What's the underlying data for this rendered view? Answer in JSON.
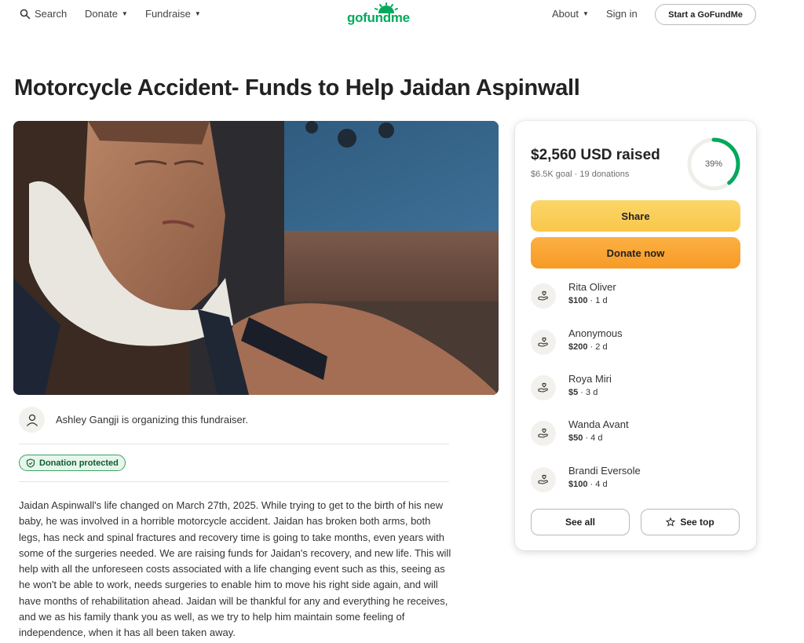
{
  "nav": {
    "search_label": "Search",
    "donate_label": "Donate",
    "fundraise_label": "Fundraise",
    "logo_text": "gofundme",
    "about_label": "About",
    "signin_label": "Sign in",
    "start_label": "Start a GoFundMe"
  },
  "campaign": {
    "title": "Motorcycle Accident- Funds to Help Jaidan Aspinwall",
    "organizer_text": "Ashley Gangji is organizing this fundraiser.",
    "protected_label": "Donation protected",
    "story": "Jaidan Aspinwall's life changed on March 27th, 2025. While trying to get to the birth of his new baby, he was involved in a horrible motorcycle accident. Jaidan has broken both arms, both legs, has neck and spinal fractures and recovery time is going to take months, even years with some of the surgeries needed. We are raising funds for Jaidan's recovery, and new life. This will help with all the unforeseen costs associated with a life changing event such as this, seeing as he won't be able to work, needs surgeries to enable him to move his right side again, and will have months of rehabilitation ahead. Jaidan will be thankful for any and everything he receives, and we as his family thank you as well, as we try to help him maintain some feeling of independence, when it has all been taken away."
  },
  "donation_card": {
    "raised_text": "$2,560 USD raised",
    "goal_text": "$6.5K goal",
    "donations_text": "19 donations",
    "progress_label": "39%",
    "progress_fraction": 0.39,
    "share_label": "Share",
    "donate_label": "Donate now",
    "donors": [
      {
        "name": "Rita Oliver",
        "amount": "$100",
        "time": "1 d"
      },
      {
        "name": "Anonymous",
        "amount": "$200",
        "time": "2 d"
      },
      {
        "name": "Roya Miri",
        "amount": "$5",
        "time": "3 d"
      },
      {
        "name": "Wanda Avant",
        "amount": "$50",
        "time": "4 d"
      },
      {
        "name": "Brandi Eversole",
        "amount": "$100",
        "time": "4 d"
      }
    ],
    "see_all_label": "See all",
    "see_top_label": "See top"
  },
  "colors": {
    "brand_green": "#02a95c",
    "share_yellow": "#f9c74a",
    "donate_orange": "#f79a25",
    "progress_green": "#02a95c"
  },
  "icons": [
    "search-icon",
    "chevron-down-icon",
    "user-icon",
    "shield-icon",
    "donation-hand-icon",
    "star-icon"
  ]
}
